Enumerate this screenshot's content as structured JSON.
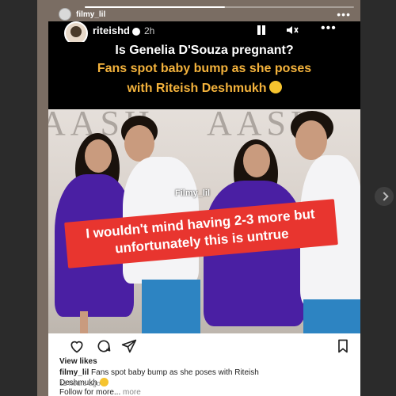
{
  "story": {
    "original_username": "filmy_lil",
    "progress": 0.52
  },
  "post": {
    "username": "riteishd",
    "time": "2h",
    "headline_question": "Is Genelia D'Souza pregnant?",
    "headline_line1": "Fans spot baby bump as she poses",
    "headline_line2": "with Riteish Deshmukh",
    "watermark": "Filmy_lil",
    "quote": "I wouldn't mind having 2-3 more but unfortunately this is untrue",
    "view_likes": "View likes",
    "caption_user": "filmy_lil",
    "caption_text": "Fans spot baby bump as she poses with Riteish Deshmukh",
    "caption_follow": "Follow for more...",
    "caption_more": "more",
    "time_ago": "11 hours ago"
  },
  "icons": {
    "like": "heart-icon",
    "comment": "comment-icon",
    "share": "send-icon",
    "save": "bookmark-icon",
    "pause": "pause-icon",
    "mute": "mute-icon",
    "more": "more-icon",
    "next": "chevron-right-icon"
  },
  "colors": {
    "quote_box": "#e8352f",
    "headline_accent": "#f3b23c",
    "dress": "#4a1fa3"
  }
}
